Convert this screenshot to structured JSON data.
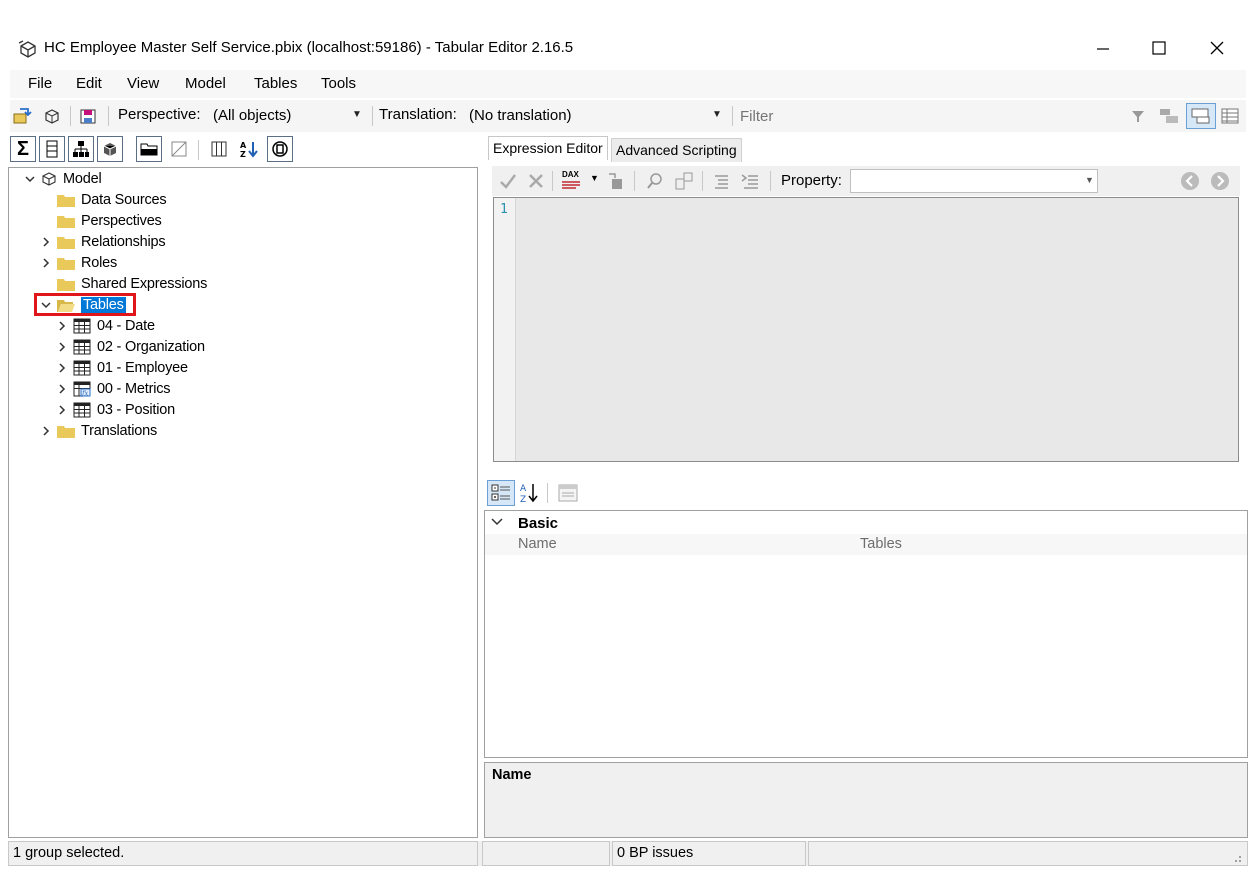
{
  "window": {
    "title": "HC Employee Master Self Service.pbix (localhost:59186) - Tabular Editor 2.16.5",
    "app_icon": "tabular-editor-icon",
    "controls": [
      "minimize-icon",
      "maximize-icon",
      "close-icon"
    ]
  },
  "menu": [
    "File",
    "Edit",
    "View",
    "Model",
    "Tables",
    "Tools"
  ],
  "toolbar": {
    "perspective_label": "Perspective:",
    "perspective_value": "(All objects)",
    "translation_label": "Translation:",
    "translation_value": "(No translation)",
    "filter_placeholder": "Filter"
  },
  "tree": {
    "root": "Model",
    "items": [
      {
        "label": "Data Sources",
        "expandable": false
      },
      {
        "label": "Perspectives",
        "expandable": false
      },
      {
        "label": "Relationships",
        "expandable": true
      },
      {
        "label": "Roles",
        "expandable": true
      },
      {
        "label": "Shared Expressions",
        "expandable": false
      },
      {
        "label": "Tables",
        "expandable": true,
        "expanded": true,
        "selected": true
      },
      {
        "label": "Translations",
        "expandable": true
      }
    ],
    "tables": [
      {
        "label": "04 - Date",
        "icon": "table-icon"
      },
      {
        "label": "02 - Organization",
        "icon": "table-icon"
      },
      {
        "label": "01 - Employee",
        "icon": "table-icon"
      },
      {
        "label": "00 - Metrics",
        "icon": "calculated-table-icon"
      },
      {
        "label": "03 - Position",
        "icon": "table-icon"
      }
    ]
  },
  "editor": {
    "tabs": [
      {
        "label": "Expression Editor",
        "active": true
      },
      {
        "label": "Advanced Scripting",
        "active": false
      }
    ],
    "dax_badge": "DAX",
    "property_label": "Property:",
    "property_value": "",
    "line_number": "1"
  },
  "properties": {
    "category": "Basic",
    "rows": [
      {
        "name": "Name",
        "value": "Tables"
      }
    ],
    "description_title": "Name"
  },
  "status": {
    "selection": "1 group selected.",
    "bp_issues": "0 BP issues"
  },
  "colors": {
    "selection": "#0078d7",
    "highlight_box": "#e0161a",
    "folder": "#e8c95a"
  }
}
